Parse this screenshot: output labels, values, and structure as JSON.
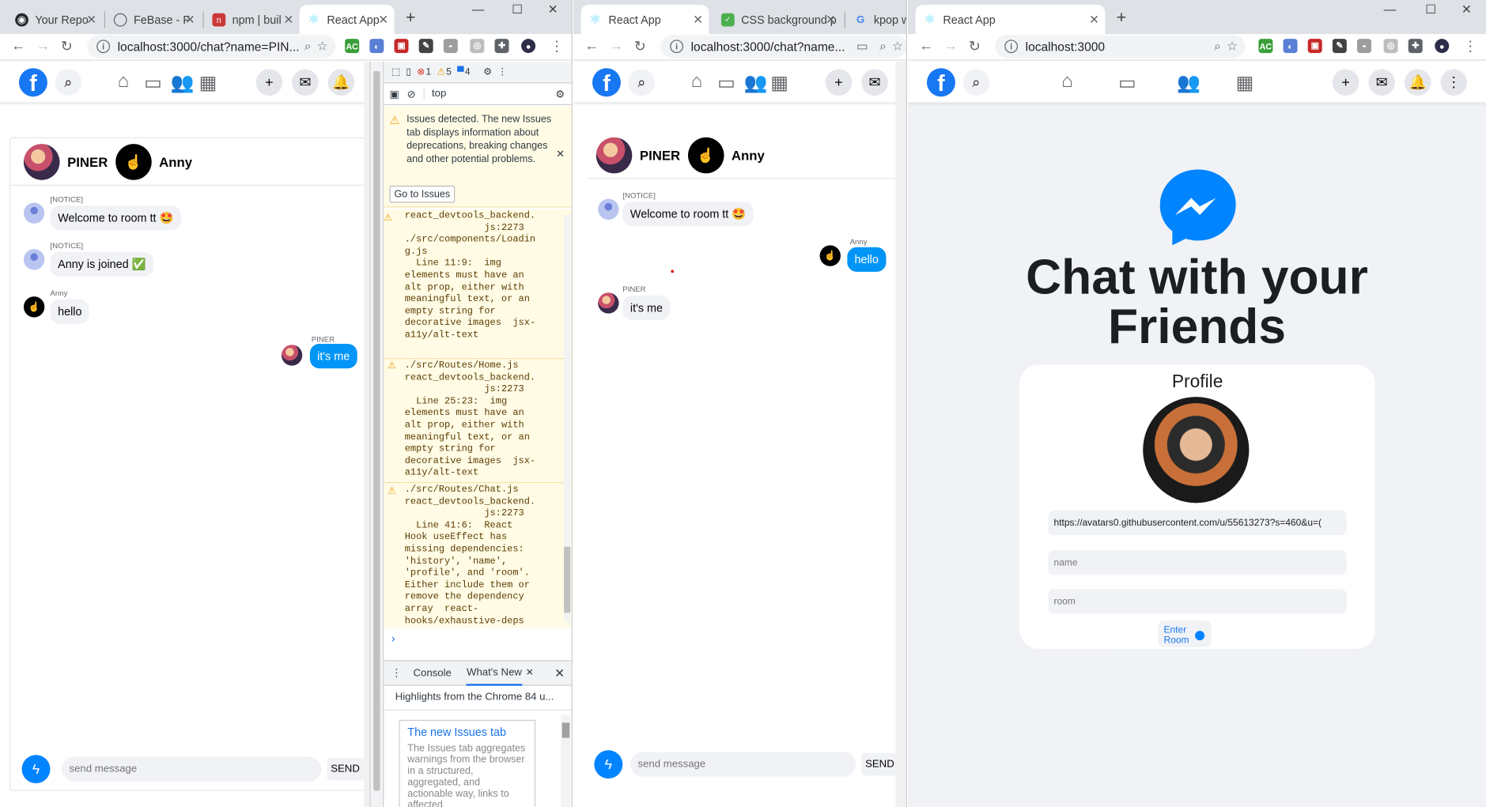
{
  "windows": {
    "left": {
      "tabs": [
        {
          "label": "Your Repo",
          "icon": "github-icon",
          "color": "#24292e"
        },
        {
          "label": "FeBase - F",
          "icon": "globe-icon",
          "color": "#5f6368"
        },
        {
          "label": "npm | buil",
          "icon": "npm-icon",
          "color": "#cb3837"
        },
        {
          "label": "React App",
          "icon": "react-icon",
          "color": "#61dafb"
        }
      ],
      "url": "localhost:3000/chat?name=PIN...",
      "chat": {
        "header_users": [
          "PINER",
          "Anny"
        ],
        "messages": [
          {
            "sender": "[NOTICE]",
            "text": "Welcome to room tt 🤩",
            "side": "left",
            "avatar": "notice"
          },
          {
            "sender": "[NOTICE]",
            "text": "Anny is joined ✅",
            "side": "left",
            "avatar": "notice"
          },
          {
            "sender": "Anny",
            "text": "hello",
            "side": "left",
            "avatar": "anny"
          },
          {
            "sender": "PINER",
            "text": "it's me",
            "side": "right",
            "avatar": "piner"
          }
        ],
        "input_placeholder": "send message",
        "send_label": "SEND"
      },
      "devtools": {
        "errors": "1",
        "warnings": "5",
        "infos": "4",
        "context": "top",
        "issues_banner": "Issues detected. The new Issues tab displays information about deprecations, breaking changes and other potential problems.",
        "go_to_issues": "Go to Issues",
        "warnings_text": [
          "react_devtools_backend.\n              js:2273\n./src/components/Loadin\ng.js\n  Line 11:9:  img\nelements must have an\nalt prop, either with\nmeaningful text, or an\nempty string for\ndecorative images  jsx-\na11y/alt-text",
          "./src/Routes/Home.js\nreact_devtools_backend.\n              js:2273\n  Line 25:23:  img\nelements must have an\nalt prop, either with\nmeaningful text, or an\nempty string for\ndecorative images  jsx-\na11y/alt-text",
          "./src/Routes/Chat.js\nreact_devtools_backend.\n              js:2273\n  Line 41:6:  React\nHook useEffect has\nmissing dependencies:\n'history', 'name',\n'profile', and 'room'.\nEither include them or\nremove the dependency\narray  react-\nhooks/exhaustive-deps"
        ],
        "drawer_tabs": [
          "Console",
          "What's New"
        ],
        "highlights": "Highlights from the Chrome 84 u...",
        "card_title": "The new Issues tab",
        "card_text": "The Issues tab aggregates warnings from the browser in a structured, aggregated, and actionable way, links to affected"
      }
    },
    "middle": {
      "tabs": [
        {
          "label": "React App",
          "icon": "react-icon",
          "color": "#61dafb"
        },
        {
          "label": "CSS background p",
          "icon": "css-icon",
          "color": "#4caf50"
        },
        {
          "label": "kpop wa",
          "icon": "google-icon",
          "color": "#4285f4"
        }
      ],
      "url": "localhost:3000/chat?name...",
      "chat": {
        "header_users": [
          "PINER",
          "Anny"
        ],
        "messages": [
          {
            "sender": "[NOTICE]",
            "text": "Welcome to room tt 🤩",
            "side": "left",
            "avatar": "notice"
          },
          {
            "sender": "Anny",
            "text": "hello",
            "side": "right",
            "avatar": "anny"
          },
          {
            "sender": "PINER",
            "text": "it's me",
            "side": "left",
            "avatar": "piner"
          }
        ],
        "input_placeholder": "send message",
        "send_label": "SEND"
      }
    },
    "right": {
      "tabs": [
        {
          "label": "React App",
          "icon": "react-icon",
          "color": "#61dafb"
        }
      ],
      "url": "localhost:3000",
      "home": {
        "headline_line1": "Chat with your",
        "headline_line2": "Friends",
        "profile_title": "Profile",
        "avatar_url_value": "https://avatars0.githubusercontent.com/u/55613273?s=460&u=(",
        "name_placeholder": "name",
        "room_placeholder": "room",
        "enter_label": "Enter Room"
      }
    }
  },
  "colors": {
    "fb_blue": "#1877f2",
    "messenger_blue": "#0084ff",
    "bubble_me": "#0095f6"
  }
}
